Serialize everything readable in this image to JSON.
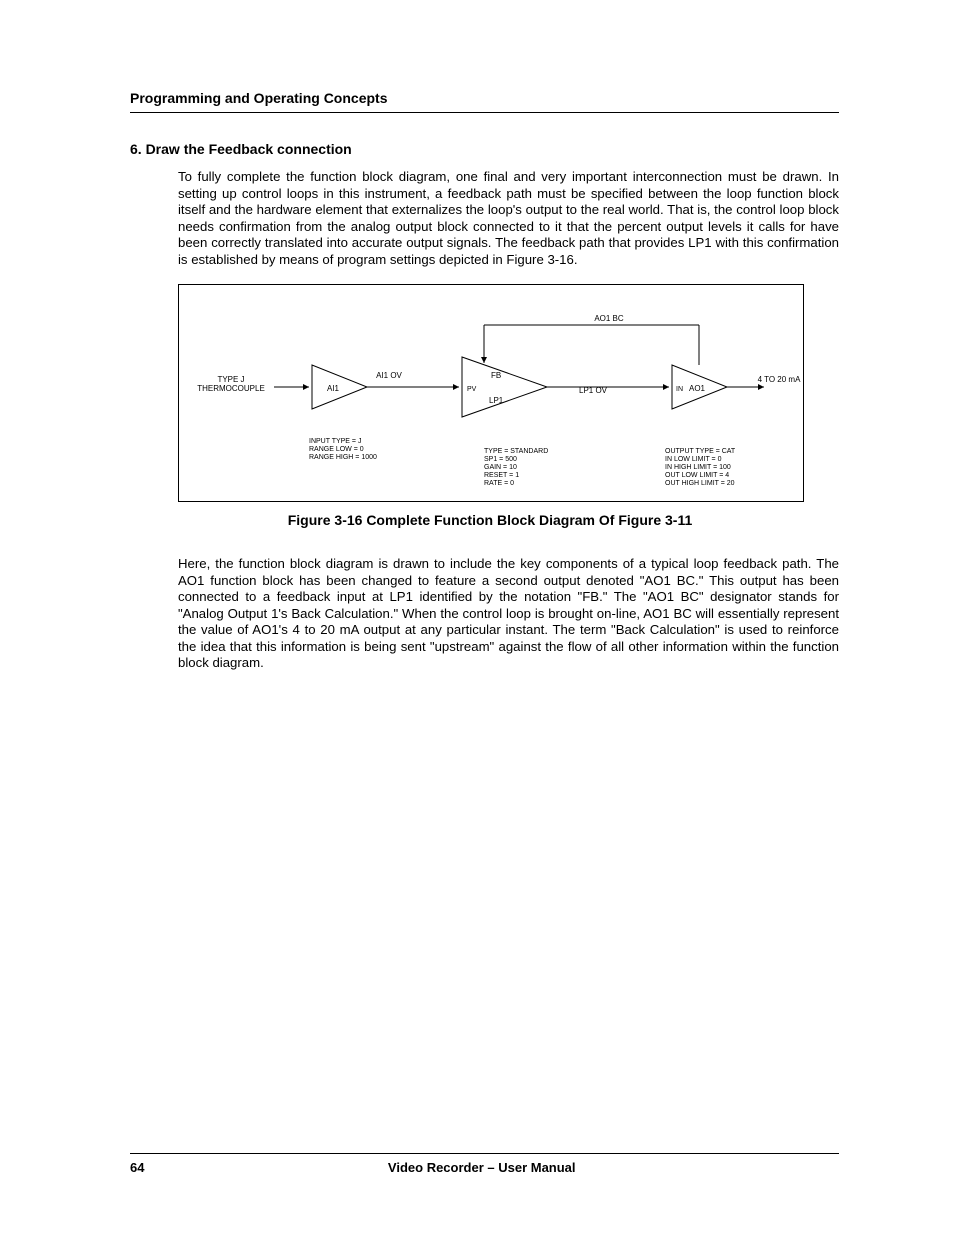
{
  "header": {
    "running": "Programming and Operating Concepts"
  },
  "section": {
    "title": "6. Draw the Feedback connection"
  },
  "para1": "To fully complete the function block diagram, one final and very important interconnection must be drawn.  In setting up control loops in this instrument, a feedback path must be specified between the loop function block itself and the hardware element that externalizes the loop's output to the real world.  That is, the control loop block needs confirmation from the analog output block connected to it that the percent output levels it calls for have been correctly translated into accurate output signals.  The feedback path that provides LP1 with this confirmation is established by means of program settings depicted in Figure 3-16.",
  "figure": {
    "caption": "Figure 3-16   Complete Function Block Diagram Of Figure 3-11",
    "input_label_1": "TYPE J",
    "input_label_2": "THERMOCOUPLE",
    "ai1": "AI1",
    "ai1_ov": "AI1 OV",
    "pv": "PV",
    "fb": "FB",
    "lp1": "LP1",
    "lp1_ov": "LP1 OV",
    "ao1_bc": "AO1 BC",
    "in": "IN",
    "ao1": "AO1",
    "out_label": "4 TO 20 mA",
    "ai1_params": {
      "l1": "INPUT TYPE  =  J",
      "l2": "RANGE LOW  =  0",
      "l3": "RANGE HIGH  =  1000"
    },
    "lp1_params": {
      "l1": "TYPE  =  STANDARD",
      "l2": "SP1  =  500",
      "l3": "GAIN  =  10",
      "l4": "RESET  =  1",
      "l5": "RATE  =  0"
    },
    "ao1_params": {
      "l1": "OUTPUT TYPE  =  CAT",
      "l2": "IN LOW LIMIT  =  0",
      "l3": "IN HIGH LIMIT  =  100",
      "l4": "OUT LOW LIMIT  =  4",
      "l5": "OUT HIGH LIMIT  =  20"
    }
  },
  "para2": "Here, the function block diagram is drawn to include the key components of a typical loop feedback path.  The AO1 function block has been changed to feature a second output denoted \"AO1 BC.\"  This output has been connected to a feedback input at LP1 identified by the notation \"FB.\"  The \"AO1 BC\" designator stands for \"Analog Output 1's Back Calculation.\"  When the control loop is brought on-line, AO1 BC will essentially represent the value of AO1's 4 to 20 mA output at any particular instant.  The term \"Back Calculation\" is used to reinforce the idea that this information is being sent \"upstream\" against the flow of all other information within the function block diagram.",
  "footer": {
    "page": "64",
    "title": "Video Recorder – User Manual"
  }
}
